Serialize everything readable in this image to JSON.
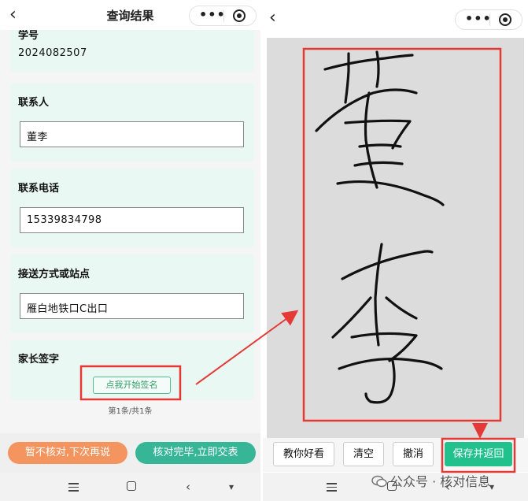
{
  "left": {
    "title": "查询结果",
    "back_icon": "chevron-left-icon",
    "more_dots": "•••",
    "fields": {
      "student_id": {
        "label": "学号",
        "value": "2024082507"
      },
      "contact": {
        "label": "联系人",
        "value": "董李"
      },
      "phone": {
        "label": "联系电话",
        "value": "15339834798"
      },
      "pickup": {
        "label": "接送方式或站点",
        "value": "雁白地铁口C出口"
      },
      "signature": {
        "label": "家长签字",
        "button": "点我开始签名"
      }
    },
    "pager": "第1条/共1条",
    "buttons": {
      "later": "暂不核对,下次再说",
      "confirm": "核对完毕,立即交表"
    }
  },
  "right": {
    "signature_strokes": "董李",
    "toolbar": {
      "demo": "教你好看",
      "clear": "清空",
      "undo": "撤消",
      "save": "保存并返回"
    }
  },
  "nav": {
    "menu_icon": "menu-icon",
    "home_icon": "home-icon",
    "back_icon": "back-icon",
    "down_icon": "down-icon"
  },
  "watermark": "公众号 · 核对信息",
  "colors": {
    "card_bg": "#eaf8f4",
    "accent_green": "#4fc08d",
    "orange_button": "#f4955f",
    "teal_button": "#36b597",
    "save_button": "#22c08c",
    "highlight_red": "#e53935"
  }
}
